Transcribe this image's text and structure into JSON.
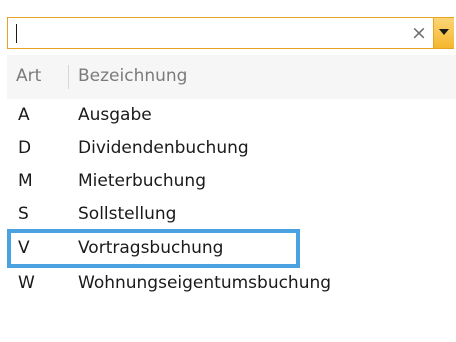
{
  "combo": {
    "value": "",
    "placeholder": ""
  },
  "list": {
    "columns": [
      "Art",
      "Bezeichnung"
    ],
    "rows": [
      {
        "code": "A",
        "name": "Ausgabe"
      },
      {
        "code": "D",
        "name": "Dividendenbuchung"
      },
      {
        "code": "M",
        "name": "Mieterbuchung"
      },
      {
        "code": "S",
        "name": "Sollstellung"
      },
      {
        "code": "V",
        "name": "Vortragsbuchung"
      },
      {
        "code": "W",
        "name": "Wohnungseigentumsbuchung"
      }
    ],
    "selected_code": "V"
  },
  "icons": {
    "clear": "close-icon",
    "dropdown": "chevron-down-icon"
  },
  "colors": {
    "accent": "#f5b72e",
    "selection_border": "#4aa3e0",
    "header_bg": "#f6f6f6"
  }
}
